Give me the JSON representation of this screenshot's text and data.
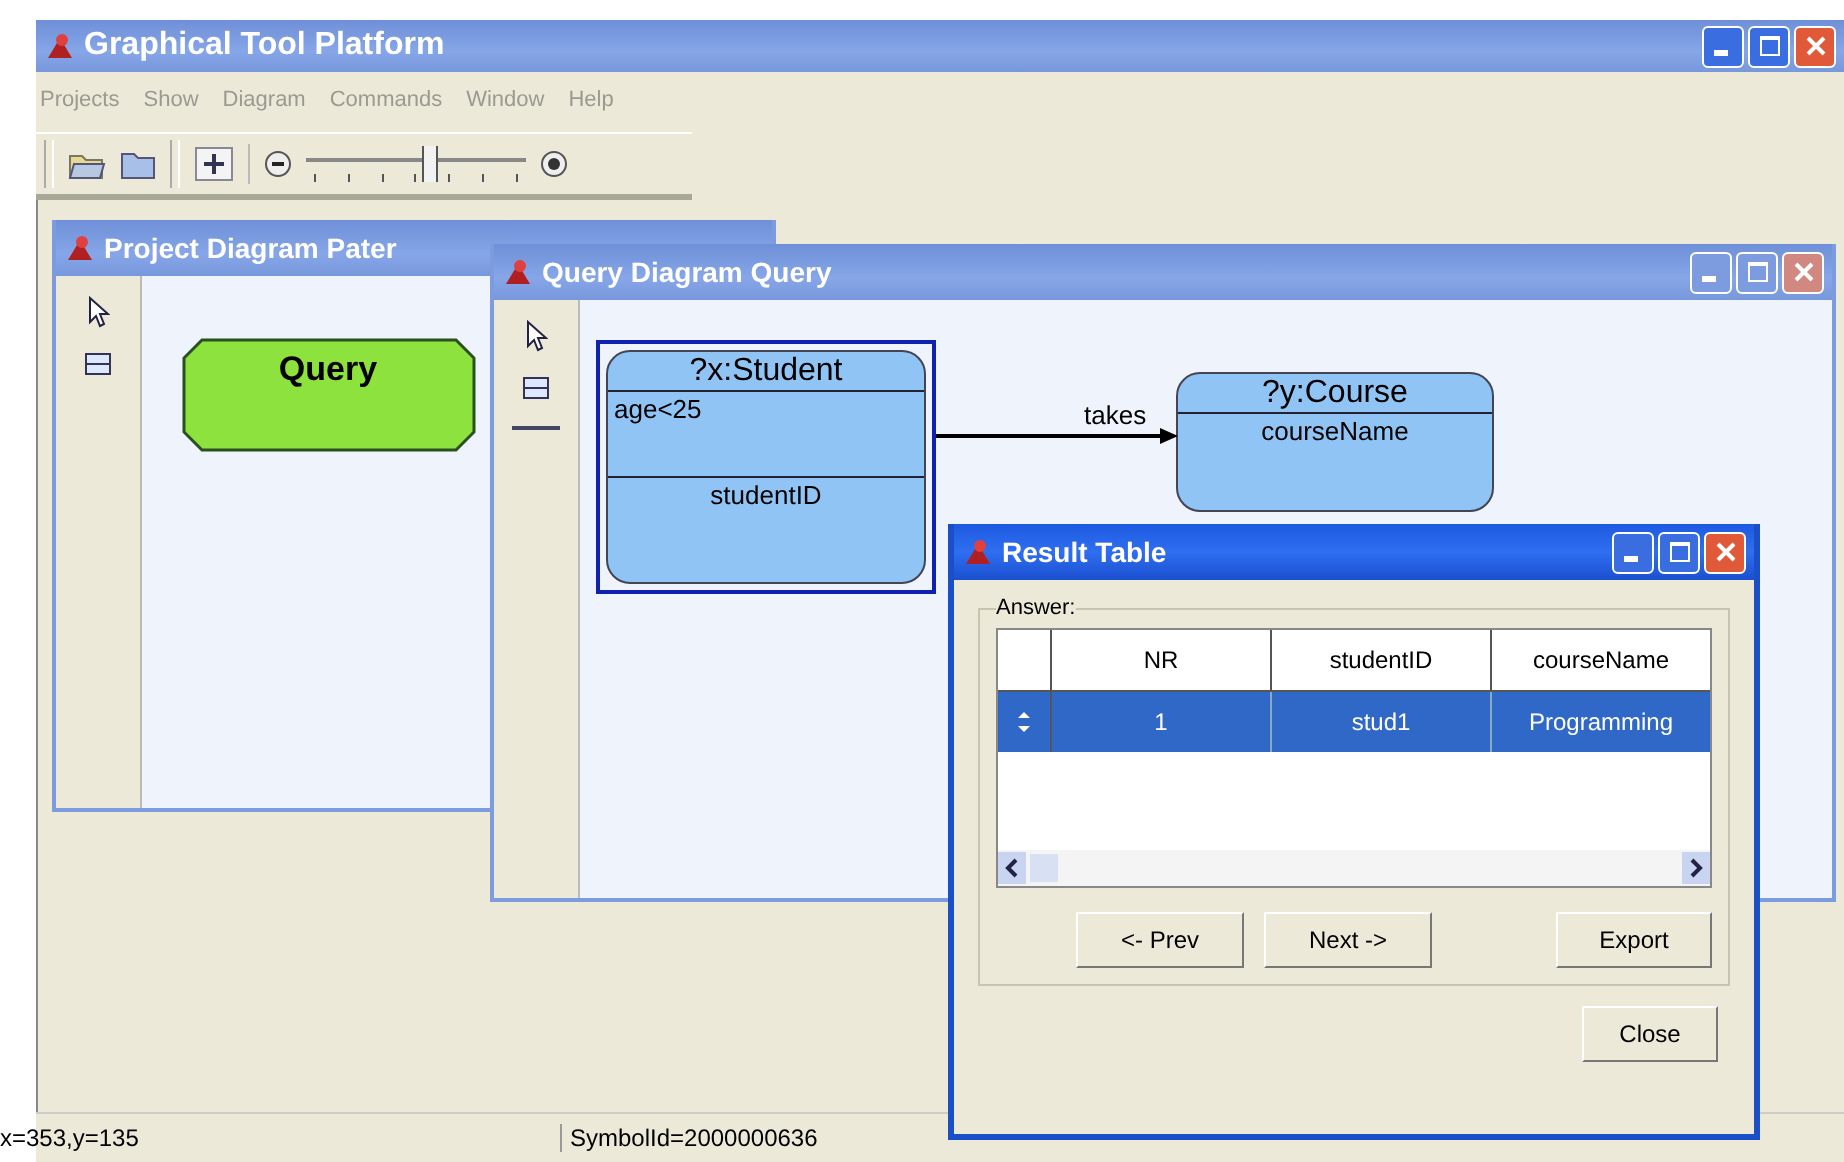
{
  "app": {
    "title": "Graphical Tool Platform"
  },
  "menu": [
    "Projects",
    "Show",
    "Diagram",
    "Commands",
    "Window",
    "Help"
  ],
  "toolbar": {
    "zoom_slider": {
      "level": 0.55
    }
  },
  "pattern_window": {
    "title": "Project Diagram Pater",
    "nodes": [
      {
        "kind": "query",
        "label": "Query"
      }
    ]
  },
  "query_window": {
    "title": "Query Diagram Query",
    "nodes": [
      {
        "header": "?x:Student",
        "sections": [
          "age<25",
          "studentID"
        ],
        "selected": true
      },
      {
        "header": "?y:Course",
        "sections": [
          "courseName"
        ],
        "selected": false
      }
    ],
    "edge": {
      "label": "takes"
    }
  },
  "result_table": {
    "title": "Result Table",
    "group_label": "Answer:",
    "columns": [
      "NR",
      "studentID",
      "courseName"
    ],
    "rows": [
      {
        "cells": [
          "1",
          "stud1",
          "Programming"
        ],
        "selected": true
      }
    ],
    "buttons": [
      "<- Prev",
      "Next ->",
      "Export"
    ],
    "close": "Close"
  },
  "status_bar": [
    "x=353,y=135",
    "SymbolId=2000000636"
  ]
}
